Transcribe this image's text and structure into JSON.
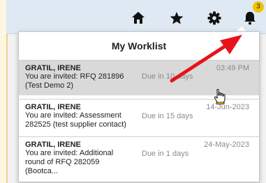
{
  "notification_badge": "3",
  "worklist": {
    "title": "My Worklist",
    "items": [
      {
        "sender": "GRATIL, IRENE",
        "message": "You are invited: RFQ 281896 (Test Demo 2)",
        "due": "Due in 10 days",
        "time": "03:49 PM"
      },
      {
        "sender": "GRATIL, IRENE",
        "message": "You are invited: Assessment 282525 (test supplier contact)",
        "due": "Due in 15 days",
        "time": "14-Jun-2023"
      },
      {
        "sender": "GRATIL, IRENE",
        "message": "You are invited: Additional round of RFQ 282059 (Bootca...",
        "due": "Due in 1 days",
        "time": "24-May-2023"
      }
    ]
  },
  "colors": {
    "header": "#dfe9f3",
    "selected_row": "#d9d9d9",
    "annotation_arrow": "#e8121a",
    "badge": "#f2c200"
  }
}
